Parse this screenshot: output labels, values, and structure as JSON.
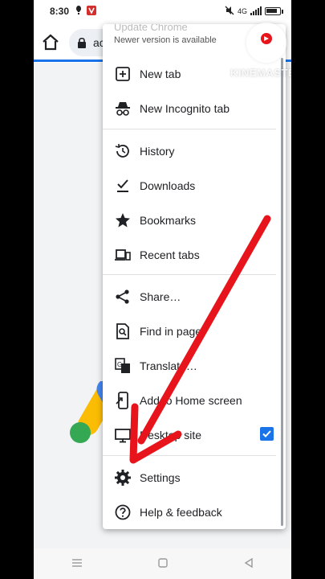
{
  "status_bar": {
    "time": "8:30",
    "signal_text": "4G"
  },
  "toolbar": {
    "url_text": "ac"
  },
  "menu": {
    "update_title": "Update Chrome",
    "update_subtitle": "Newer version is available",
    "items": [
      {
        "label": "New tab",
        "icon": "plus-box-icon"
      },
      {
        "label": "New Incognito tab",
        "icon": "incognito-icon"
      },
      {
        "label": "History",
        "icon": "history-icon"
      },
      {
        "label": "Downloads",
        "icon": "download-check-icon"
      },
      {
        "label": "Bookmarks",
        "icon": "star-icon"
      },
      {
        "label": "Recent tabs",
        "icon": "devices-icon"
      },
      {
        "label": "Share…",
        "icon": "share-icon"
      },
      {
        "label": "Find in page",
        "icon": "find-in-page-icon"
      },
      {
        "label": "Translate…",
        "icon": "translate-icon"
      },
      {
        "label": "Add to Home screen",
        "icon": "add-to-home-icon"
      },
      {
        "label": "Desktop site",
        "icon": "monitor-icon",
        "checked": true
      },
      {
        "label": "Settings",
        "icon": "gear-icon"
      },
      {
        "label": "Help & feedback",
        "icon": "help-icon"
      }
    ]
  },
  "watermark": {
    "text": "KINEMASTER"
  },
  "colors": {
    "accent": "#1a73e8",
    "annotation_arrow": "#e8141c"
  }
}
